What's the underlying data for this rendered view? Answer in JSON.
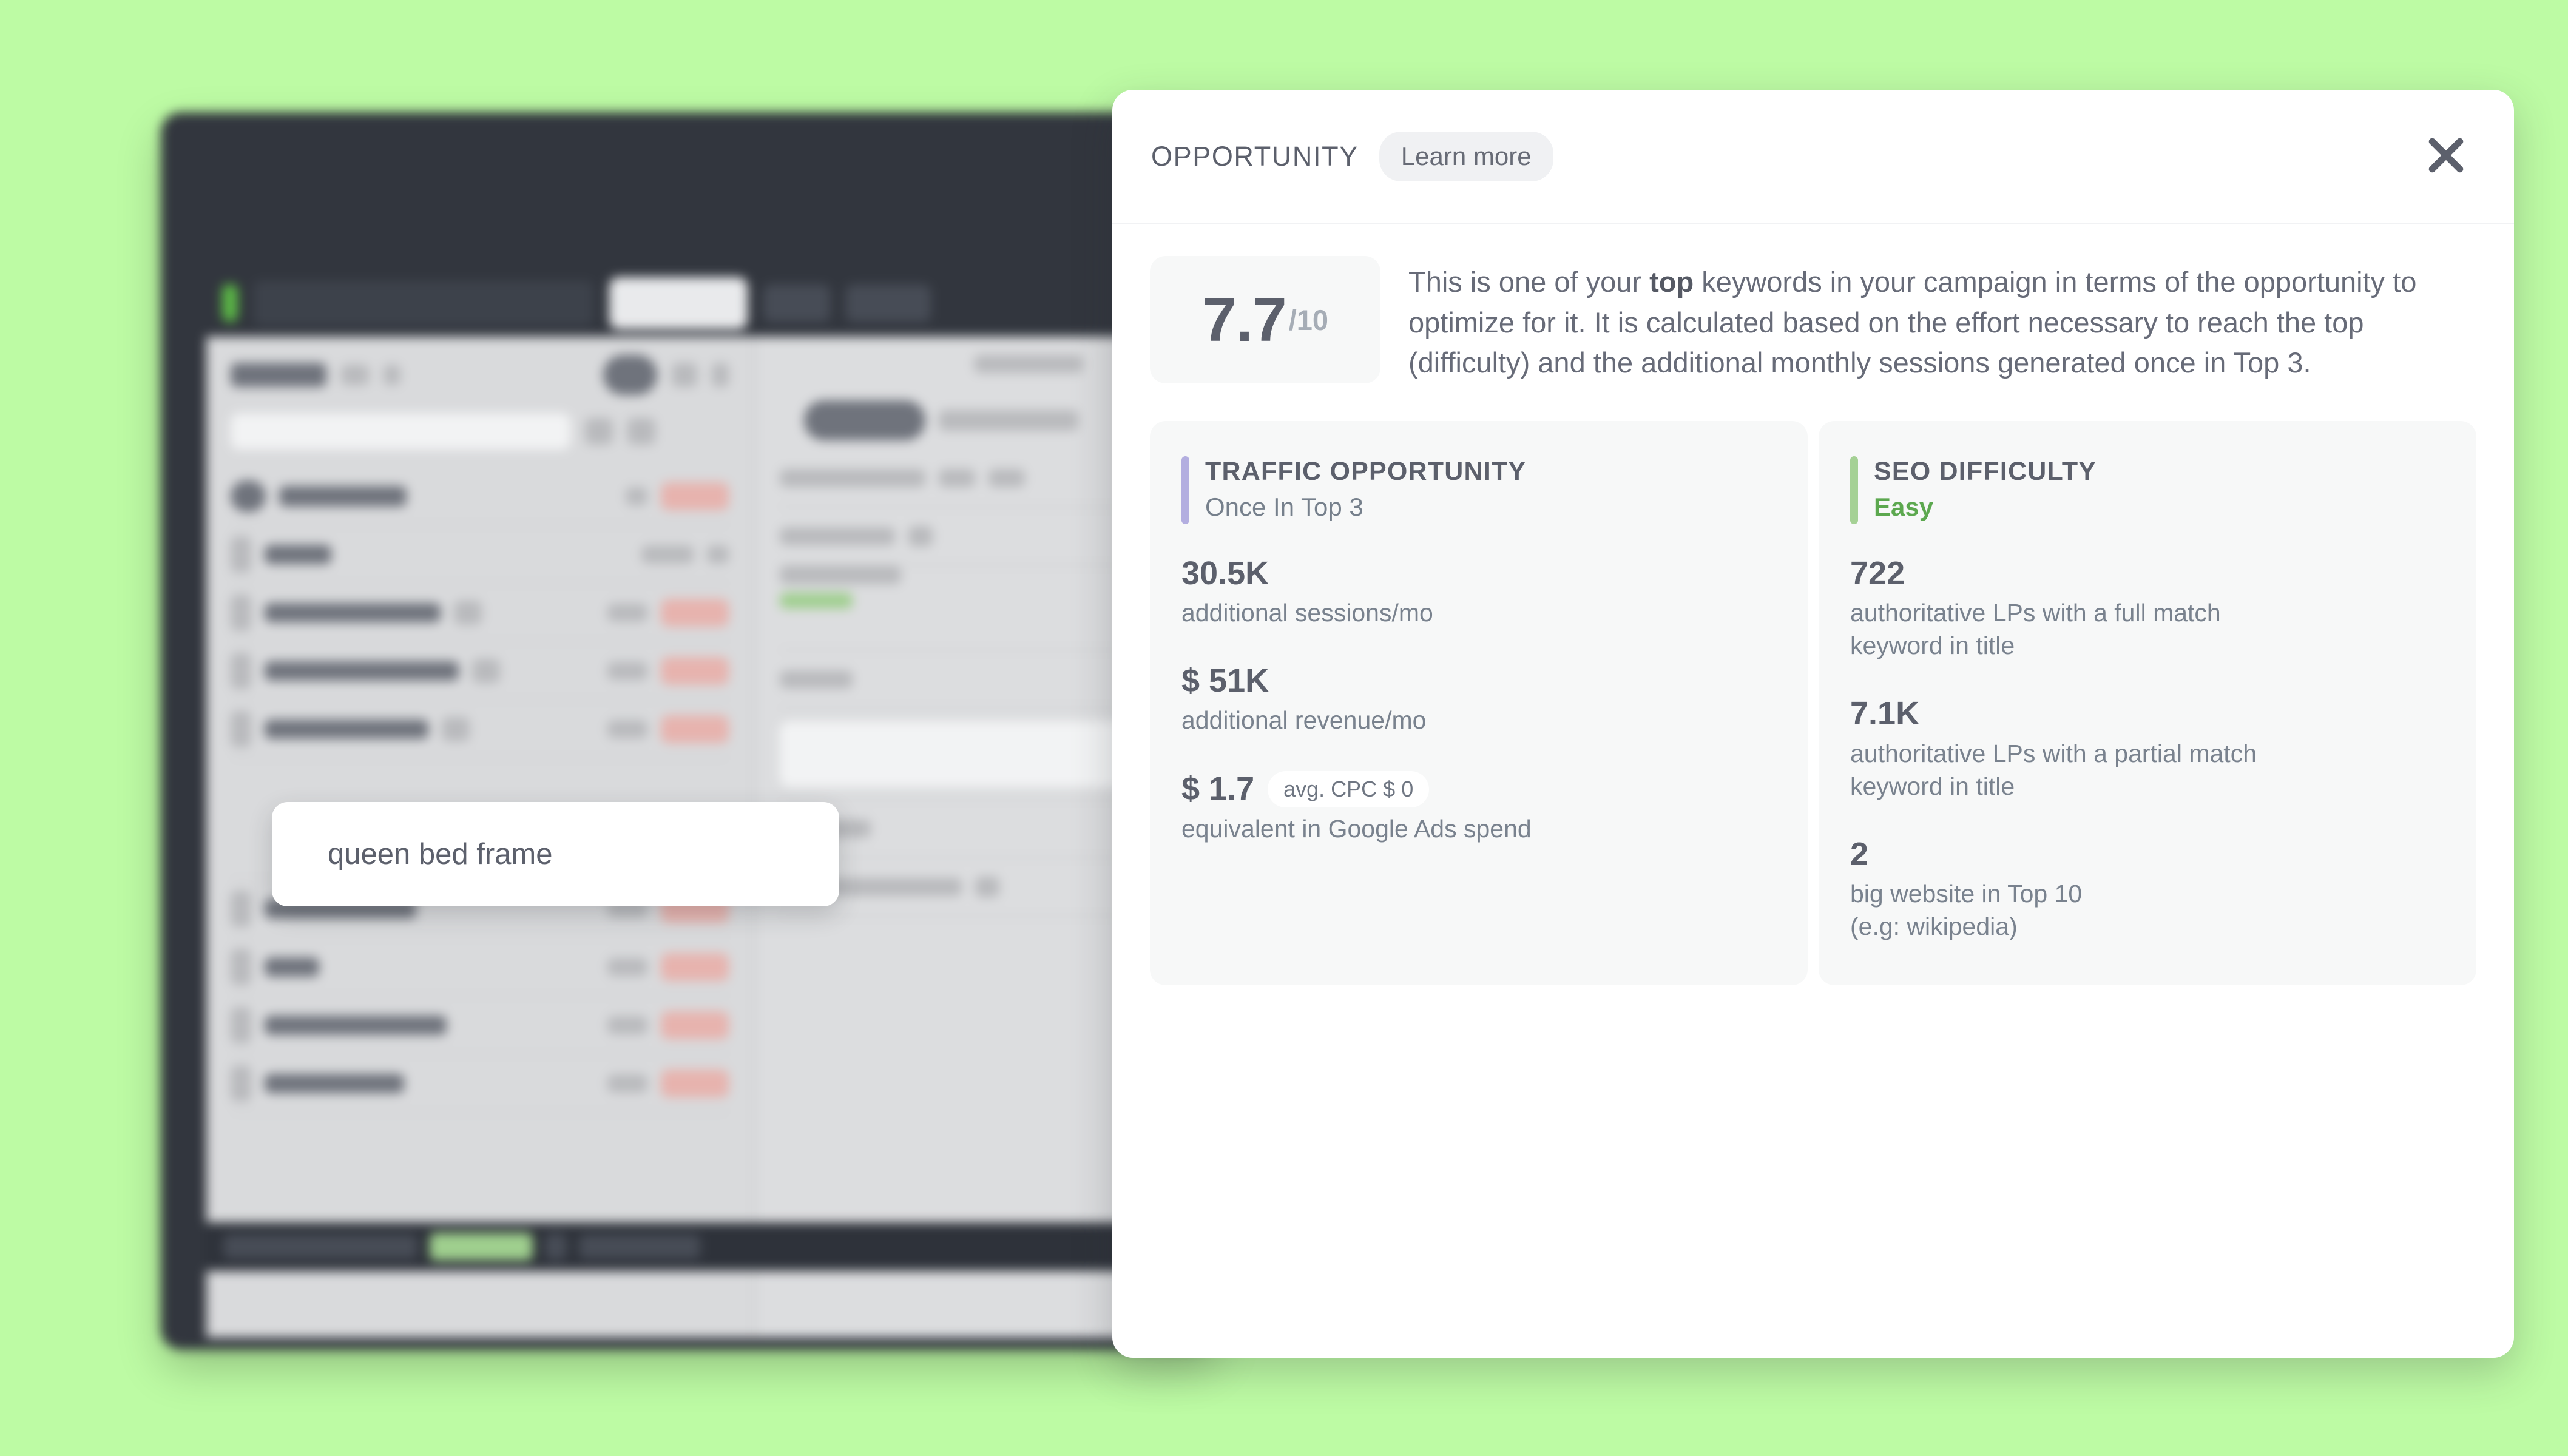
{
  "colors": {
    "page_background": "#bdfba4",
    "app_frame": "#32363e",
    "panel_background": "#ffffff",
    "accent_traffic": "#b3aee0",
    "accent_difficulty": "#a5d195",
    "difficulty_text": "#5ca84f",
    "text_primary": "#5c606c",
    "text_secondary": "#79828e"
  },
  "tooltip": {
    "keyword": "queen bed frame"
  },
  "panel": {
    "title": "OPPORTUNITY",
    "learn_more_label": "Learn more",
    "close_icon": "close-icon",
    "score": {
      "value": "7.7",
      "denominator": "/10"
    },
    "summary": {
      "part1": "This is one of your ",
      "emphasis": "top",
      "part2": " keywords in your campaign in terms of the opportunity to optimize for it. It is calculated based on the effort necessary to reach the top (difficulty) and the additional monthly sessions generated once in Top 3."
    },
    "cards": [
      {
        "accent_color": "#b3aee0",
        "title": "TRAFFIC OPPORTUNITY",
        "subtitle": "Once In Top 3",
        "subtitle_style": "normal",
        "metrics": [
          {
            "value": "30.5K",
            "badge": "",
            "caption": "additional sessions/mo"
          },
          {
            "value": "$ 51K",
            "badge": "",
            "caption": "additional revenue/mo"
          },
          {
            "value": "$ 1.7",
            "badge": "avg. CPC $ 0",
            "caption": "equivalent in Google Ads spend"
          }
        ]
      },
      {
        "accent_color": "#a5d195",
        "title": "SEO DIFFICULTY",
        "subtitle": "Easy",
        "subtitle_style": "easy",
        "metrics": [
          {
            "value": "722",
            "badge": "",
            "caption": "authoritative LPs with a full match keyword in title"
          },
          {
            "value": "7.1K",
            "badge": "",
            "caption": "authoritative LPs with a partial match keyword in title"
          },
          {
            "value": "2",
            "badge": "",
            "caption": "big website in Top 10 (e.g: wikipedia)"
          }
        ]
      }
    ]
  }
}
